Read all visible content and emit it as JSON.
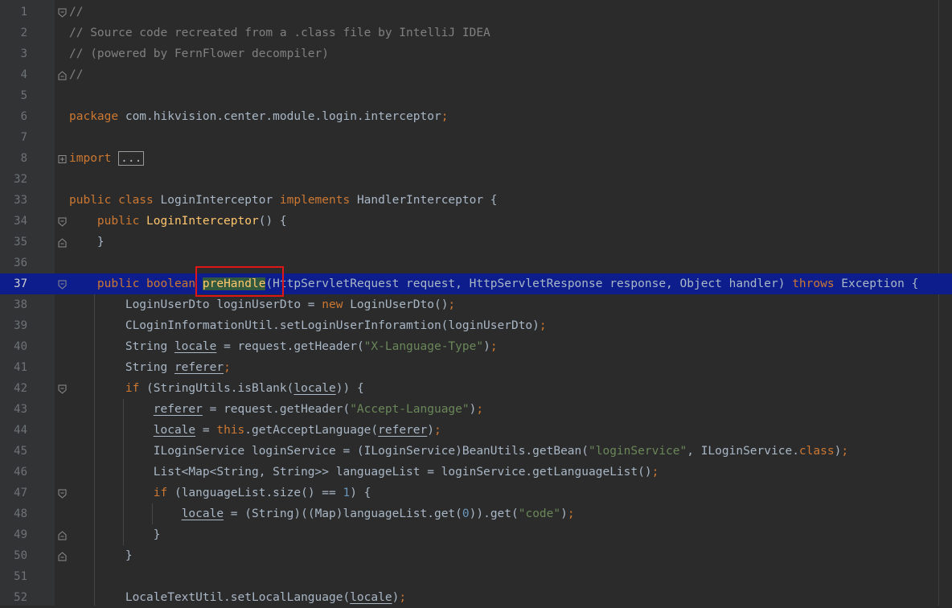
{
  "editor": {
    "lines": [
      {
        "num": "1",
        "fold": "open",
        "tokens": [
          {
            "t": "//",
            "c": "cm"
          }
        ]
      },
      {
        "num": "2",
        "tokens": [
          {
            "t": "// Source code recreated from a .class file by IntelliJ IDEA",
            "c": "cm"
          }
        ]
      },
      {
        "num": "3",
        "tokens": [
          {
            "t": "// (powered by FernFlower decompiler)",
            "c": "cm"
          }
        ]
      },
      {
        "num": "4",
        "fold": "close",
        "tokens": [
          {
            "t": "//",
            "c": "cm"
          }
        ]
      },
      {
        "num": "5",
        "tokens": []
      },
      {
        "num": "6",
        "tokens": [
          {
            "t": "package",
            "c": "kw"
          },
          {
            "t": " com.hikvision.center.module.login.interceptor"
          },
          {
            "t": ";",
            "c": "kw"
          }
        ]
      },
      {
        "num": "7",
        "tokens": []
      },
      {
        "num": "8",
        "fold": "collapsed",
        "tokens": [
          {
            "t": "import",
            "c": "kw"
          },
          {
            "t": " "
          },
          {
            "t": "...",
            "c": "dots"
          }
        ]
      },
      {
        "num": "32",
        "tokens": []
      },
      {
        "num": "33",
        "tokens": [
          {
            "t": "public class ",
            "c": "kw"
          },
          {
            "t": "LoginInterceptor "
          },
          {
            "t": "implements ",
            "c": "kw"
          },
          {
            "t": "HandlerInterceptor {"
          }
        ]
      },
      {
        "num": "34",
        "fold": "open",
        "tokens": [
          {
            "t": "    "
          },
          {
            "t": "public ",
            "c": "kw"
          },
          {
            "t": "LoginInterceptor",
            "c": "fn"
          },
          {
            "t": "() {"
          }
        ]
      },
      {
        "num": "35",
        "fold": "close",
        "tokens": [
          {
            "t": "    }"
          }
        ]
      },
      {
        "num": "36",
        "tokens": []
      },
      {
        "num": "37",
        "fold": "open",
        "highlight": true,
        "tokens": [
          {
            "t": "    "
          },
          {
            "t": "public boolean ",
            "c": "kw"
          },
          {
            "t": "preHandle",
            "c": "sel"
          },
          {
            "t": "(HttpServletRequest request, HttpServletResponse response, Object handler) "
          },
          {
            "t": "throws ",
            "c": "kw"
          },
          {
            "t": "Exception {"
          }
        ]
      },
      {
        "num": "38",
        "tokens": [
          {
            "t": "        LoginUserDto loginUserDto = "
          },
          {
            "t": "new ",
            "c": "kw"
          },
          {
            "t": "LoginUserDto()"
          },
          {
            "t": ";",
            "c": "kw"
          }
        ]
      },
      {
        "num": "39",
        "tokens": [
          {
            "t": "        CLoginInformationUtil.setLoginUserInforamtion(loginUserDto)"
          },
          {
            "t": ";",
            "c": "kw"
          }
        ]
      },
      {
        "num": "40",
        "tokens": [
          {
            "t": "        String "
          },
          {
            "t": "locale",
            "c": "ul"
          },
          {
            "t": " = request.getHeader("
          },
          {
            "t": "\"X-Language-Type\"",
            "c": "str"
          },
          {
            "t": ")"
          },
          {
            "t": ";",
            "c": "kw"
          }
        ]
      },
      {
        "num": "41",
        "tokens": [
          {
            "t": "        String "
          },
          {
            "t": "referer",
            "c": "ul"
          },
          {
            "t": ";",
            "c": "kw"
          }
        ]
      },
      {
        "num": "42",
        "fold": "open",
        "tokens": [
          {
            "t": "        "
          },
          {
            "t": "if ",
            "c": "kw"
          },
          {
            "t": "(StringUtils.isBlank("
          },
          {
            "t": "locale",
            "c": "ul"
          },
          {
            "t": ")) {"
          }
        ]
      },
      {
        "num": "43",
        "tokens": [
          {
            "t": "            "
          },
          {
            "t": "referer",
            "c": "ul"
          },
          {
            "t": " = request.getHeader("
          },
          {
            "t": "\"Accept-Language\"",
            "c": "str"
          },
          {
            "t": ")"
          },
          {
            "t": ";",
            "c": "kw"
          }
        ]
      },
      {
        "num": "44",
        "tokens": [
          {
            "t": "            "
          },
          {
            "t": "locale",
            "c": "ul"
          },
          {
            "t": " = "
          },
          {
            "t": "this",
            "c": "kw"
          },
          {
            "t": ".getAcceptLanguage("
          },
          {
            "t": "referer",
            "c": "ul"
          },
          {
            "t": ")"
          },
          {
            "t": ";",
            "c": "kw"
          }
        ]
      },
      {
        "num": "45",
        "tokens": [
          {
            "t": "            ILoginService loginService = (ILoginService)BeanUtils.getBean("
          },
          {
            "t": "\"loginService\"",
            "c": "str"
          },
          {
            "t": ", "
          },
          {
            "t": "ILoginService."
          },
          {
            "t": "class",
            "c": "kw"
          },
          {
            "t": ")"
          },
          {
            "t": ";",
            "c": "kw"
          }
        ]
      },
      {
        "num": "46",
        "tokens": [
          {
            "t": "            List<Map<String, String>> languageList = loginService.getLanguageList()"
          },
          {
            "t": ";",
            "c": "kw"
          }
        ]
      },
      {
        "num": "47",
        "fold": "open",
        "tokens": [
          {
            "t": "            "
          },
          {
            "t": "if ",
            "c": "kw"
          },
          {
            "t": "(languageList.size() == "
          },
          {
            "t": "1",
            "c": "num"
          },
          {
            "t": ") {"
          }
        ]
      },
      {
        "num": "48",
        "tokens": [
          {
            "t": "                "
          },
          {
            "t": "locale",
            "c": "ul"
          },
          {
            "t": " = (String)((Map)languageList.get("
          },
          {
            "t": "0",
            "c": "num"
          },
          {
            "t": ")).get("
          },
          {
            "t": "\"code\"",
            "c": "str"
          },
          {
            "t": ")"
          },
          {
            "t": ";",
            "c": "kw"
          }
        ]
      },
      {
        "num": "49",
        "fold": "close",
        "tokens": [
          {
            "t": "            }"
          }
        ]
      },
      {
        "num": "50",
        "fold": "close",
        "tokens": [
          {
            "t": "        }"
          }
        ]
      },
      {
        "num": "51",
        "tokens": []
      },
      {
        "num": "52",
        "tokens": [
          {
            "t": "        LocaleTextUtil.setLocalLanguage("
          },
          {
            "t": "locale",
            "c": "ul"
          },
          {
            "t": ")"
          },
          {
            "t": ";",
            "c": "kw"
          }
        ]
      }
    ]
  }
}
